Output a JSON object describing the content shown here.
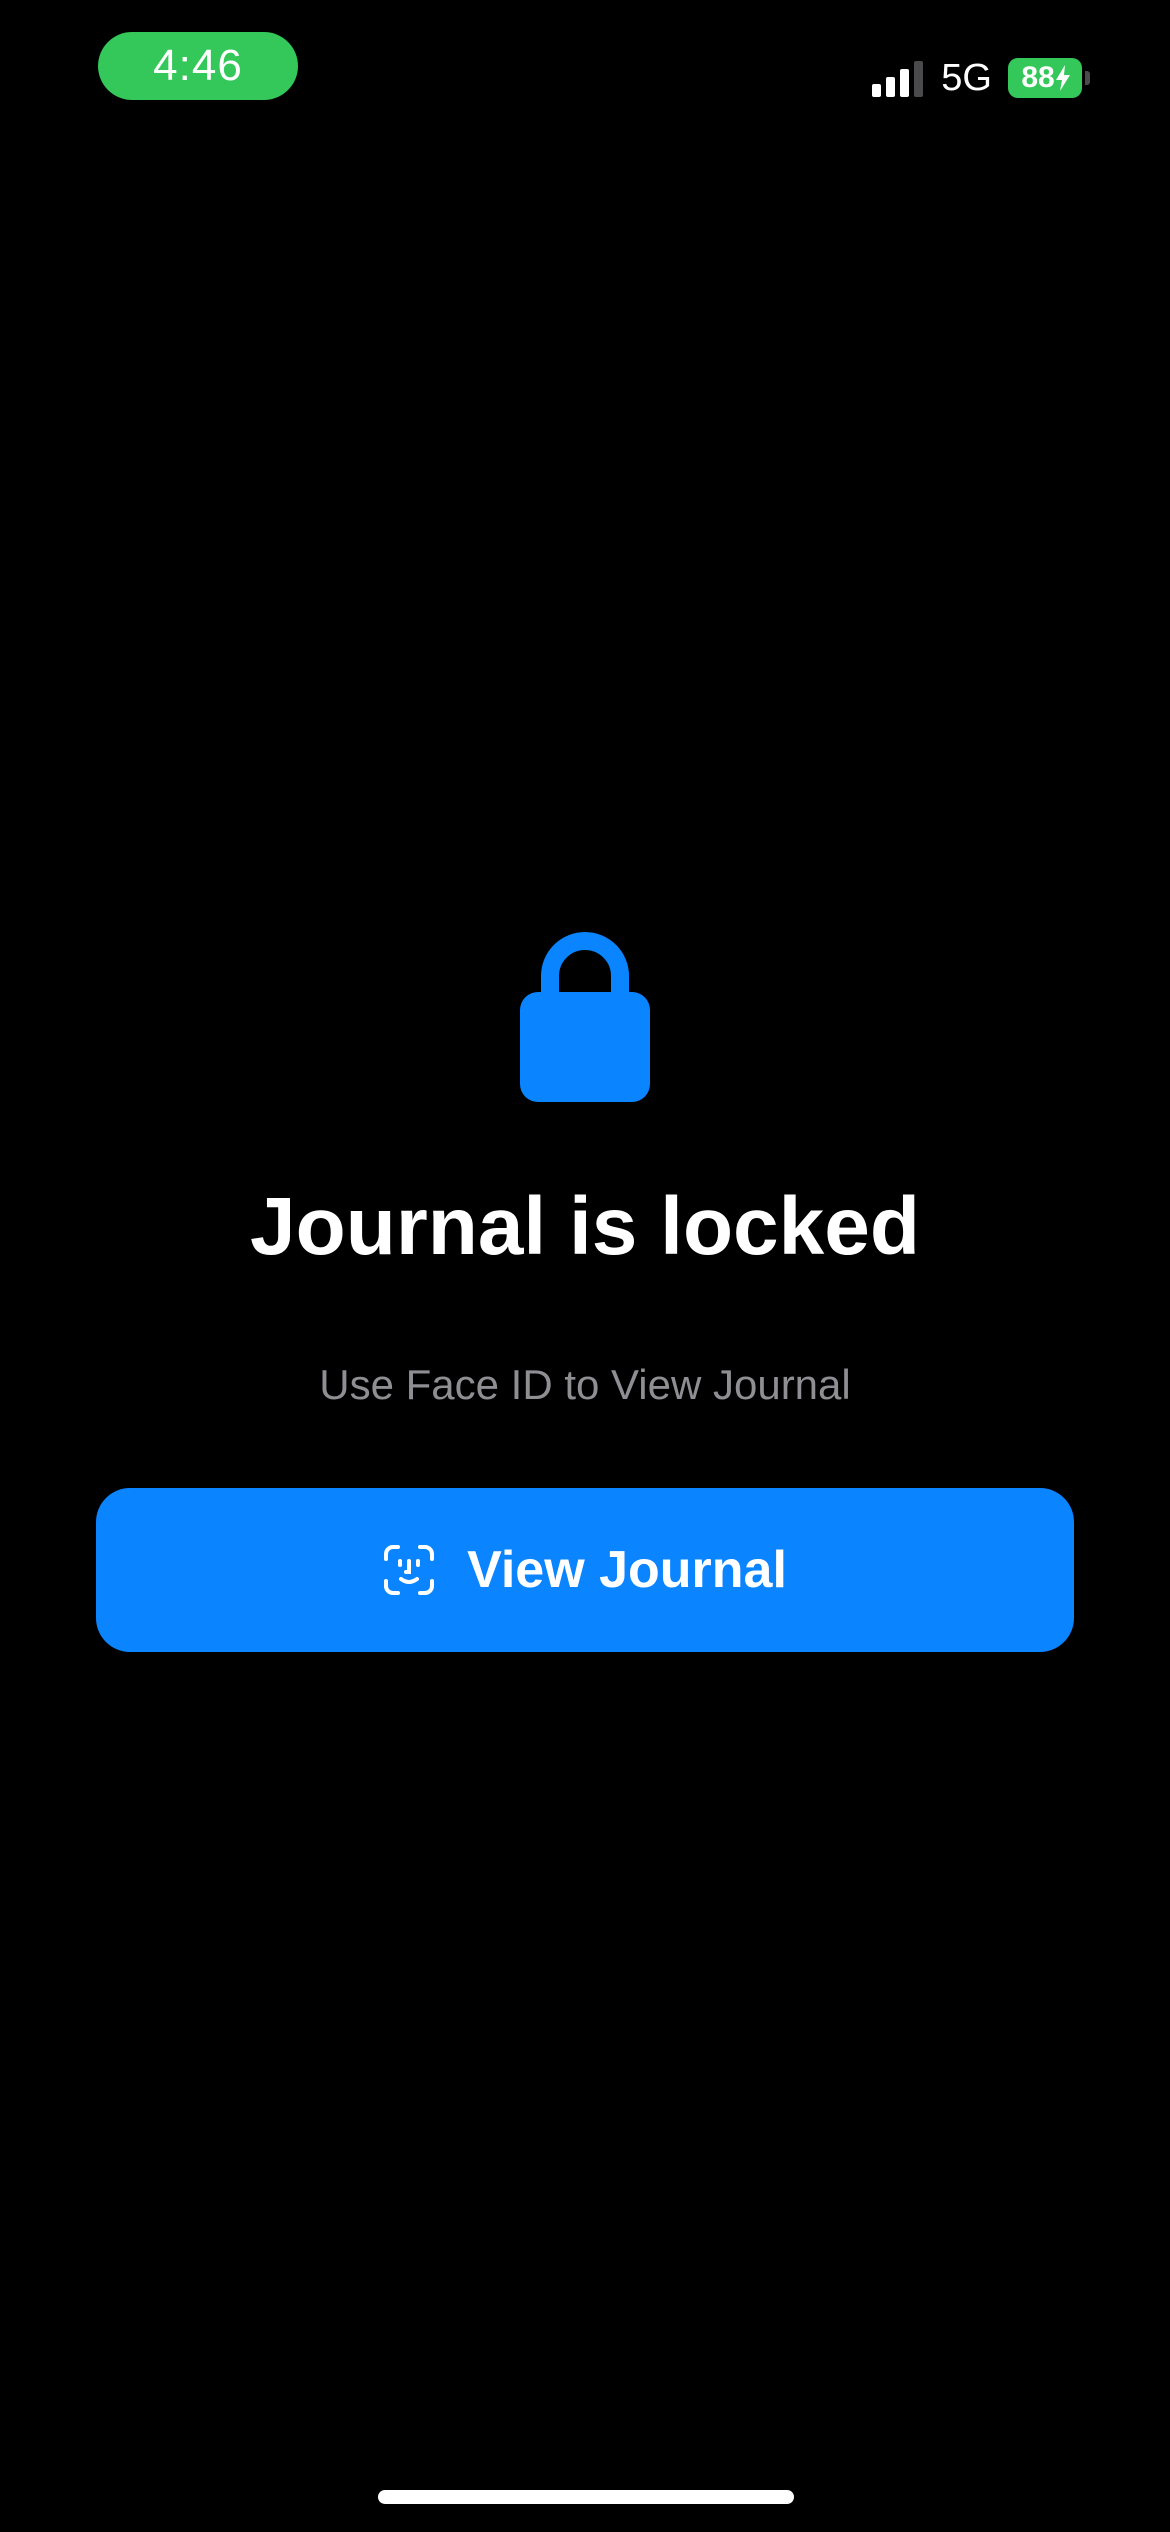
{
  "status_bar": {
    "time": "4:46",
    "network": "5G",
    "battery_level": "88",
    "battery_charging": true,
    "signal_bars_active": 3,
    "signal_bars_total": 4,
    "time_pill_color": "#34c759",
    "battery_color": "#34c759"
  },
  "lock_screen": {
    "icon": "lock-icon",
    "title": "Journal is locked",
    "subtitle": "Use Face ID to View Journal",
    "button": {
      "label": "View Journal",
      "icon": "faceid-icon",
      "color": "#0a84ff"
    }
  },
  "colors": {
    "background": "#000000",
    "accent": "#0a84ff",
    "secondary_text": "#8e8e93"
  }
}
